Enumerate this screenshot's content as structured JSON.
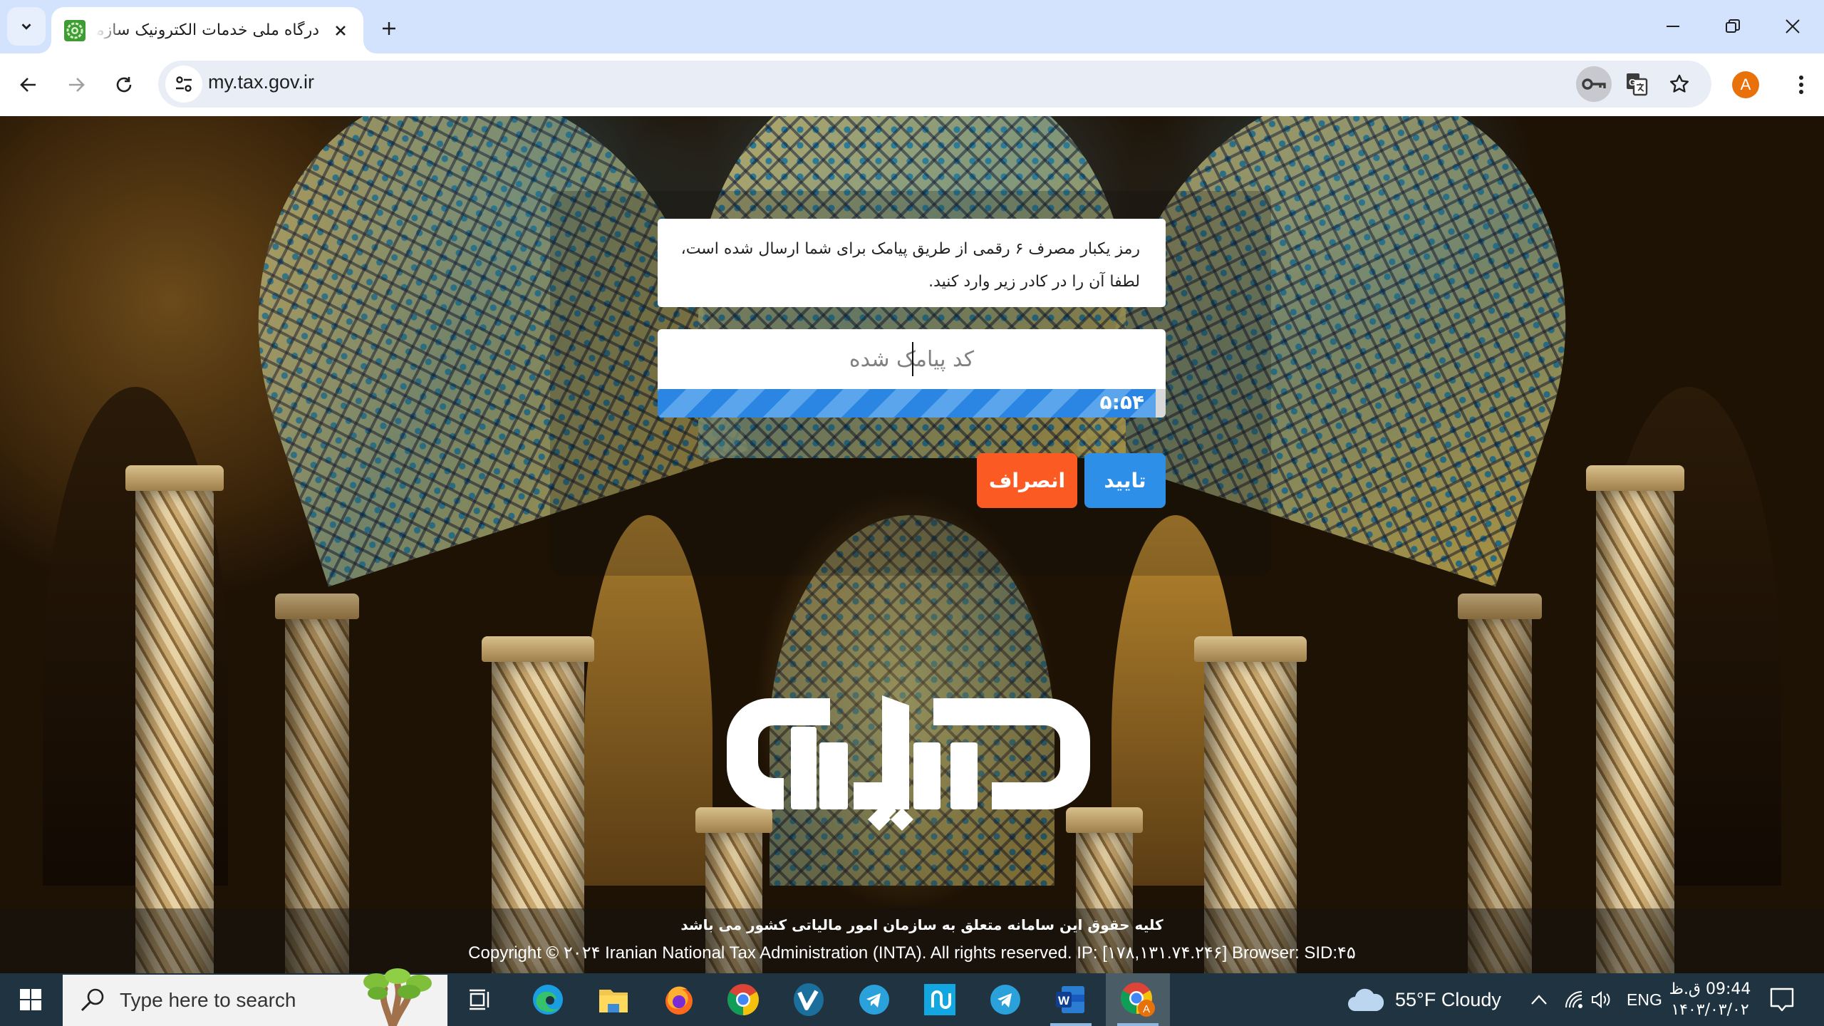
{
  "browser": {
    "tab_title": "درگاه ملی خدمات الکترونیک سازمان امور مالیاتی",
    "url": "my.tax.gov.ir",
    "profile_initial": "A",
    "accent_color": "#d3e3fd"
  },
  "page": {
    "message_line1": "رمز یکبار مصرف ۶ رقمی از طریق پیامک برای شما ارسال شده است،",
    "message_line2": "لطفا آن را در کادر زیر وارد کنید.",
    "otp_input": {
      "value": "",
      "placeholder": "کد پیامک شده"
    },
    "timer": {
      "text": "۵:۵۴",
      "remaining_fraction": 0.98,
      "color": "#2a86e2"
    },
    "buttons": {
      "confirm": "تایید",
      "cancel": "انصراف",
      "confirm_color": "#2e8fe8",
      "cancel_color": "#fb5a22"
    },
    "logo_text": "مالیات",
    "footer": {
      "fa": "کلیه حقوق این سامانه متعلق به سازمان امور مالیاتی کشور می باشد",
      "en": "Copyright © ۲۰۲۴ Iranian National Tax Administration (INTA). All rights reserved. IP: [۱۷۸,۱۳۱.۷۴.۲۴۶] Browser: SID:۴۵"
    }
  },
  "taskbar": {
    "search_placeholder": "Type here to search",
    "apps": [
      {
        "name": "task-view",
        "icon": "task-view-icon"
      },
      {
        "name": "edge",
        "icon": "edge-icon"
      },
      {
        "name": "file-explorer",
        "icon": "folder-icon"
      },
      {
        "name": "firefox",
        "icon": "firefox-icon"
      },
      {
        "name": "chrome",
        "icon": "chrome-icon"
      },
      {
        "name": "v-app",
        "icon": "v-app-icon"
      },
      {
        "name": "telegram",
        "icon": "telegram-icon"
      },
      {
        "name": "blue-app",
        "icon": "blue-app-icon"
      },
      {
        "name": "telegram-2",
        "icon": "telegram-icon"
      },
      {
        "name": "word",
        "icon": "word-icon"
      },
      {
        "name": "chrome-profile",
        "icon": "chrome-icon"
      }
    ],
    "weather": "55°F  Cloudy",
    "language": "ENG",
    "time": "09:44 ق.ظ",
    "date": "۱۴۰۳/۰۳/۰۲"
  }
}
